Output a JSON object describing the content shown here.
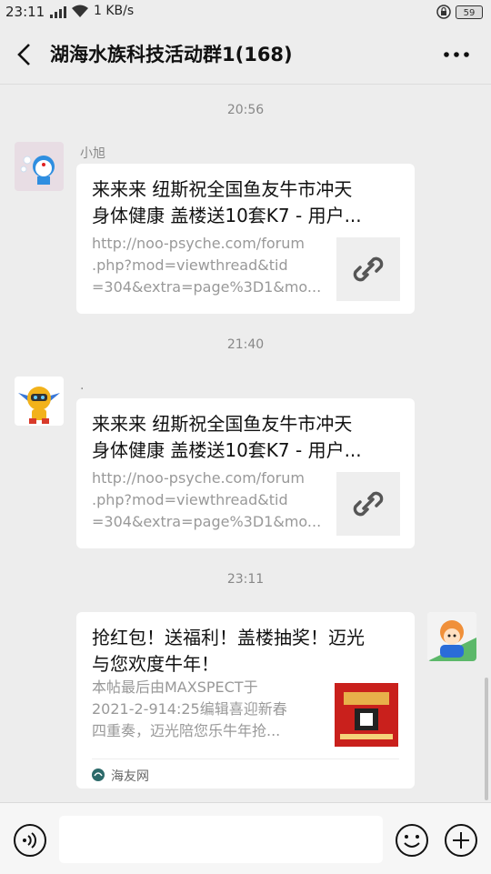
{
  "status": {
    "time": "23:11",
    "network": "4G",
    "speed": "1 KB/s",
    "battery": "59"
  },
  "header": {
    "title": "湖海水族科技活动群1(168)"
  },
  "messages": [
    {
      "time": "20:56",
      "sender": "小旭",
      "title_line1": "来来来 纽斯祝全国鱼友牛市冲天",
      "title_line2": "身体健康 盖楼送10套K7 - 用户...",
      "desc_line1": "http://noo-psyche.com/forum",
      "desc_line2": ".php?mod=viewthread&tid",
      "desc_line3": "=304&extra=page%3D1&mo..."
    },
    {
      "time": "21:40",
      "sender": ".",
      "title_line1": "来来来 纽斯祝全国鱼友牛市冲天",
      "title_line2": "身体健康 盖楼送10套K7 - 用户...",
      "desc_line1": "http://noo-psyche.com/forum",
      "desc_line2": ".php?mod=viewthread&tid",
      "desc_line3": "=304&extra=page%3D1&mo..."
    },
    {
      "time": "23:11",
      "title_line1": "抢红包！送福利！盖楼抽奖！迈光",
      "title_line2": "与您欢度牛年！",
      "desc_line1": "本帖最后由MAXSPECT于",
      "desc_line2": "2021-2-914:25编辑喜迎新春",
      "desc_line3": "四重奏，迈光陪您乐牛年抢...",
      "source": "海友网"
    }
  ],
  "colors": {
    "background": "#ededed",
    "card": "#ffffff",
    "muted": "#999999"
  }
}
